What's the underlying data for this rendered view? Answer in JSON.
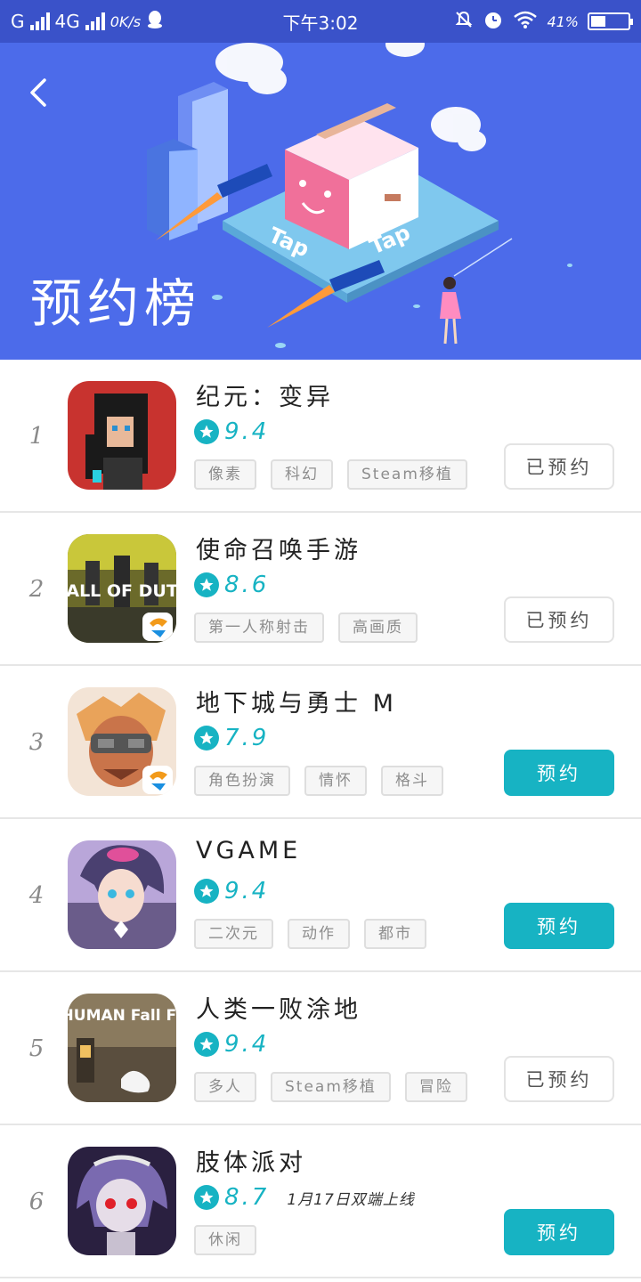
{
  "status_bar": {
    "carrier": "G",
    "network": "4G",
    "speed": "0K/s",
    "time": "下午3:02",
    "battery": "41%",
    "battery_level": 0.41,
    "icons": [
      "signal-icon",
      "qq-icon",
      "mute-icon",
      "alarm-icon",
      "wifi-icon",
      "battery-icon"
    ]
  },
  "banner": {
    "title": "预约榜",
    "brand_text": [
      "Tap",
      "Tap"
    ],
    "background_color": "#4c6bea"
  },
  "colors": {
    "accent": "#17b3c3",
    "status_bar": "#3a52c9"
  },
  "items": [
    {
      "rank": "1",
      "name": "纪元：变异",
      "score": "9.4",
      "note": "",
      "tags": [
        "像素",
        "科幻",
        "Steam移植"
      ],
      "button": "已预约",
      "booked": true
    },
    {
      "rank": "2",
      "name": "使命召唤手游",
      "score": "8.6",
      "note": "",
      "tags": [
        "第一人称射击",
        "高画质"
      ],
      "button": "已预约",
      "booked": true,
      "icon_text": "CALL OF DUTY"
    },
    {
      "rank": "3",
      "name": "地下城与勇士 M",
      "score": "7.9",
      "note": "",
      "tags": [
        "角色扮演",
        "情怀",
        "格斗"
      ],
      "button": "预约",
      "booked": false
    },
    {
      "rank": "4",
      "name": "VGAME",
      "score": "9.4",
      "note": "",
      "tags": [
        "二次元",
        "动作",
        "都市"
      ],
      "button": "预约",
      "booked": false
    },
    {
      "rank": "5",
      "name": "人类一败涂地",
      "score": "9.4",
      "note": "",
      "tags": [
        "多人",
        "Steam移植",
        "冒险"
      ],
      "button": "已预约",
      "booked": true,
      "icon_text": "HUMAN Fall Flat"
    },
    {
      "rank": "6",
      "name": "肢体派对",
      "score": "8.7",
      "note": "1月17日双端上线",
      "tags": [
        "休闲"
      ],
      "button": "预约",
      "booked": false
    }
  ]
}
